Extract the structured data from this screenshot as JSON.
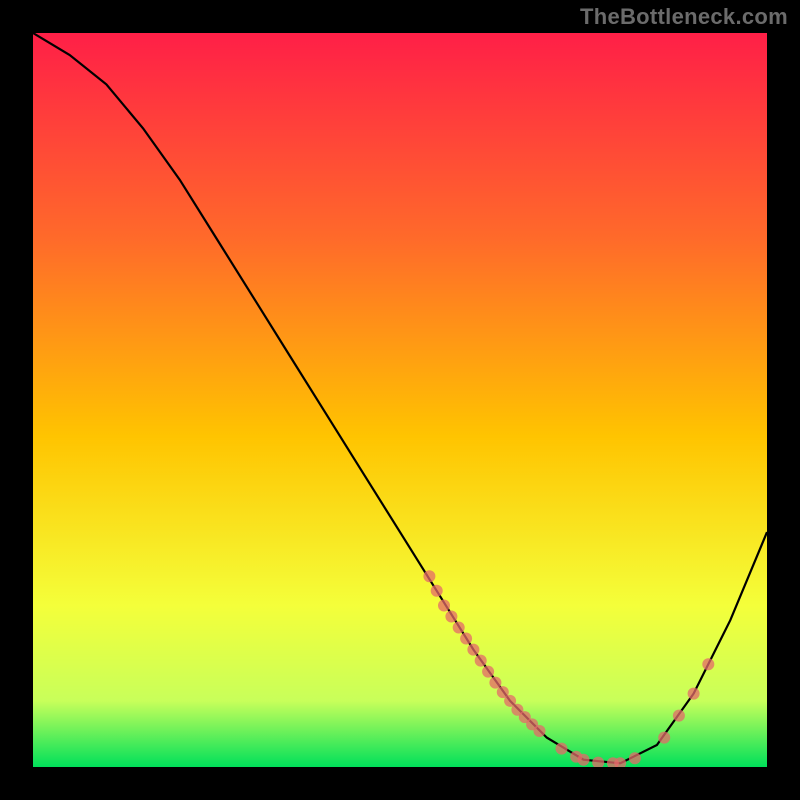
{
  "watermark": "TheBottleneck.com",
  "colors": {
    "gradient_top": "#ff1f47",
    "gradient_mid": "#ffd400",
    "gradient_bottom": "#00e05a",
    "curve": "#000000",
    "dots": "#e46a6a",
    "frame": "#000000"
  },
  "chart_data": {
    "type": "line",
    "title": "",
    "xlabel": "",
    "ylabel": "",
    "xlim": [
      0,
      100
    ],
    "ylim": [
      0,
      100
    ],
    "grid": false,
    "legend": false,
    "curve": [
      {
        "x": 0,
        "y": 100
      },
      {
        "x": 5,
        "y": 97
      },
      {
        "x": 10,
        "y": 93
      },
      {
        "x": 15,
        "y": 87
      },
      {
        "x": 20,
        "y": 80
      },
      {
        "x": 25,
        "y": 72
      },
      {
        "x": 30,
        "y": 64
      },
      {
        "x": 35,
        "y": 56
      },
      {
        "x": 40,
        "y": 48
      },
      {
        "x": 45,
        "y": 40
      },
      {
        "x": 50,
        "y": 32
      },
      {
        "x": 55,
        "y": 24
      },
      {
        "x": 60,
        "y": 16
      },
      {
        "x": 65,
        "y": 9
      },
      {
        "x": 70,
        "y": 4
      },
      {
        "x": 75,
        "y": 1
      },
      {
        "x": 80,
        "y": 0.5
      },
      {
        "x": 85,
        "y": 3
      },
      {
        "x": 90,
        "y": 10
      },
      {
        "x": 95,
        "y": 20
      },
      {
        "x": 100,
        "y": 32
      }
    ],
    "dots": [
      {
        "x": 54,
        "y": 26
      },
      {
        "x": 55,
        "y": 24
      },
      {
        "x": 56,
        "y": 22
      },
      {
        "x": 57,
        "y": 20.5
      },
      {
        "x": 58,
        "y": 19
      },
      {
        "x": 59,
        "y": 17.5
      },
      {
        "x": 60,
        "y": 16
      },
      {
        "x": 61,
        "y": 14.5
      },
      {
        "x": 62,
        "y": 13
      },
      {
        "x": 63,
        "y": 11.5
      },
      {
        "x": 64,
        "y": 10.2
      },
      {
        "x": 65,
        "y": 9
      },
      {
        "x": 66,
        "y": 7.8
      },
      {
        "x": 67,
        "y": 6.8
      },
      {
        "x": 68,
        "y": 5.8
      },
      {
        "x": 69,
        "y": 4.9
      },
      {
        "x": 72,
        "y": 2.5
      },
      {
        "x": 74,
        "y": 1.4
      },
      {
        "x": 75,
        "y": 1
      },
      {
        "x": 77,
        "y": 0.6
      },
      {
        "x": 79,
        "y": 0.5
      },
      {
        "x": 80,
        "y": 0.5
      },
      {
        "x": 82,
        "y": 1.2
      },
      {
        "x": 86,
        "y": 4
      },
      {
        "x": 88,
        "y": 7
      },
      {
        "x": 90,
        "y": 10
      },
      {
        "x": 92,
        "y": 14
      }
    ]
  }
}
